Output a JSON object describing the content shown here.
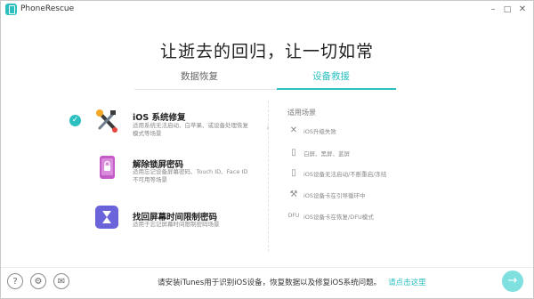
{
  "app": {
    "title": "PhoneRescue"
  },
  "window_controls": {
    "minimize": "–",
    "maximize": "□",
    "close": "✕"
  },
  "main_title": "让逝去的回归，让一切如常",
  "tabs": [
    {
      "label": "数据恢复",
      "active": false
    },
    {
      "label": "设备救援",
      "active": true
    }
  ],
  "options": [
    {
      "title": "iOS 系统修复",
      "desc": "适用系统无法启动、白苹果、或设备处理恢复模式等场景",
      "icon": "wrench-screwdriver-icon",
      "selected": true
    },
    {
      "title": "解除锁屏密码",
      "desc": "适用忘记设备屏幕密码、Touch ID、Face ID 不可用等场景",
      "icon": "phone-lock-icon",
      "selected": false
    },
    {
      "title": "找回屏幕时间限制密码",
      "desc": "适用于忘记屏幕时间限制密码场景",
      "icon": "hourglass-icon",
      "selected": false
    }
  ],
  "scenarios": {
    "title": "适用场景",
    "items": [
      {
        "label": "iOS升级失败",
        "icon": "cross-tools-icon"
      },
      {
        "label": "白屏、黑屏、蓝屏",
        "icon": "phone-screen-icon"
      },
      {
        "label": "iOS设备无法启动/不断重启/冻结",
        "icon": "phone-restart-icon"
      },
      {
        "label": "iOS设备卡在引导循环中",
        "icon": "loop-tools-icon"
      },
      {
        "label": "iOS设备卡在恢复/DFU模式",
        "icon": "dfu-icon"
      }
    ]
  },
  "footer": {
    "text": "请安装iTunes用于识别iOS设备，恢复数据以及修复iOS系统问题。",
    "link": "请点击这里",
    "help_icon": "?",
    "settings_icon": "⚙",
    "mail_icon": "✉",
    "next_icon": "→"
  },
  "colors": {
    "accent": "#2bbfc0",
    "next_button": "#7fe0e0"
  }
}
